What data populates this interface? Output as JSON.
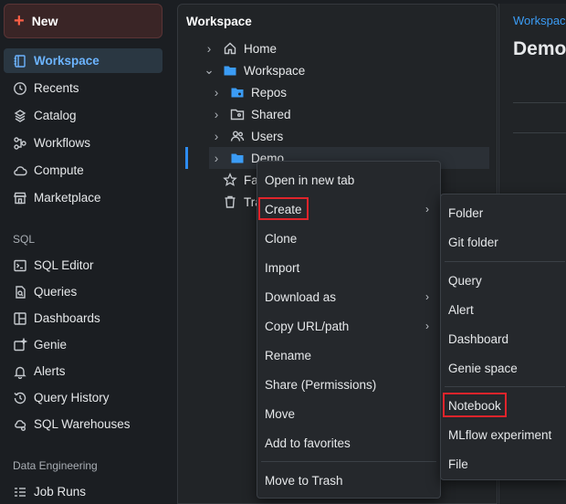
{
  "sidebar": {
    "new_label": "New",
    "items": [
      {
        "label": "Workspace",
        "icon": "workspace-icon",
        "active": true
      },
      {
        "label": "Recents",
        "icon": "clock-icon"
      },
      {
        "label": "Catalog",
        "icon": "catalog-icon"
      },
      {
        "label": "Workflows",
        "icon": "workflows-icon"
      },
      {
        "label": "Compute",
        "icon": "cloud-icon"
      },
      {
        "label": "Marketplace",
        "icon": "store-icon"
      }
    ],
    "sql_label": "SQL",
    "sql_items": [
      {
        "label": "SQL Editor",
        "icon": "terminal-icon"
      },
      {
        "label": "Queries",
        "icon": "queries-icon"
      },
      {
        "label": "Dashboards",
        "icon": "dashboard-icon"
      },
      {
        "label": "Genie",
        "icon": "genie-icon"
      },
      {
        "label": "Alerts",
        "icon": "bell-icon"
      },
      {
        "label": "Query History",
        "icon": "history-icon"
      },
      {
        "label": "SQL Warehouses",
        "icon": "warehouse-icon"
      }
    ],
    "de_label": "Data Engineering",
    "de_items": [
      {
        "label": "Job Runs",
        "icon": "job-runs-icon"
      }
    ]
  },
  "browser": {
    "title": "Workspace",
    "tree": [
      {
        "label": "Home"
      },
      {
        "label": "Workspace"
      },
      {
        "label": "Repos"
      },
      {
        "label": "Shared"
      },
      {
        "label": "Users"
      },
      {
        "label": "Demo"
      },
      {
        "label": "Fa"
      },
      {
        "label": "Tra"
      }
    ]
  },
  "right": {
    "crumb": "Workspace",
    "heading": "Demo"
  },
  "context_menu": {
    "items": [
      {
        "label": "Open in new tab"
      },
      {
        "label": "Create"
      },
      {
        "label": "Clone"
      },
      {
        "label": "Import"
      },
      {
        "label": "Download as"
      },
      {
        "label": "Copy URL/path"
      },
      {
        "label": "Rename"
      },
      {
        "label": "Share (Permissions)"
      },
      {
        "label": "Move"
      },
      {
        "label": "Add to favorites"
      },
      {
        "label": "Move to Trash"
      }
    ]
  },
  "create_submenu": {
    "items": [
      {
        "label": "Folder"
      },
      {
        "label": "Git folder"
      },
      {
        "label": "Query"
      },
      {
        "label": "Alert"
      },
      {
        "label": "Dashboard"
      },
      {
        "label": "Genie space"
      },
      {
        "label": "Notebook"
      },
      {
        "label": "MLflow experiment"
      },
      {
        "label": "File"
      }
    ]
  },
  "colors": {
    "accent": "#3b9cf5",
    "highlight": "#e0242b",
    "new_plus": "#ff5f46"
  }
}
